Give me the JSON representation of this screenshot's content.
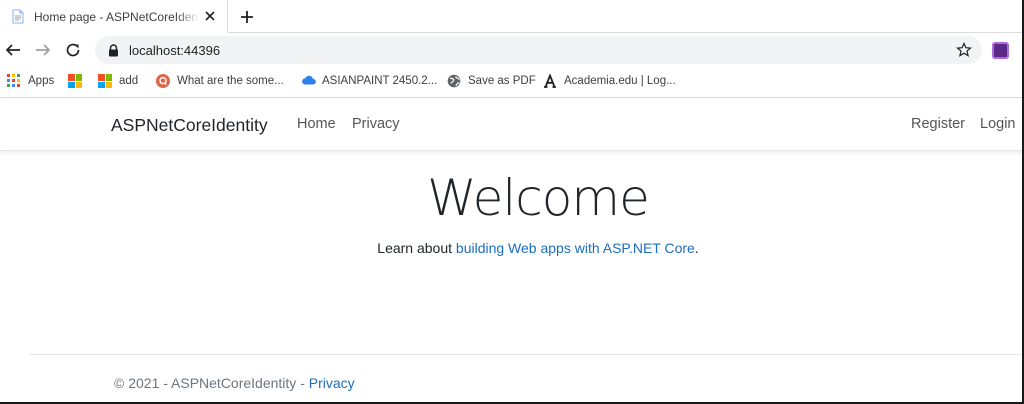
{
  "browser": {
    "tab_title": "Home page - ASPNetCoreIdentity",
    "url": "localhost:44396",
    "bookmarks": [
      {
        "label": "Apps",
        "icon": "apps-grid-icon"
      },
      {
        "label": "",
        "icon": "microsoft-logo-icon"
      },
      {
        "label": "add",
        "icon": "microsoft-logo-icon"
      },
      {
        "label": "What are the some...",
        "icon": "quora-icon"
      },
      {
        "label": "ASIANPAINT 2450.2...",
        "icon": "cloud-icon"
      },
      {
        "label": "Save as PDF",
        "icon": "globe-icon"
      },
      {
        "label": "Academia.edu | Log...",
        "icon": "academia-icon"
      }
    ]
  },
  "site": {
    "brand": "ASPNetCoreIdentity",
    "nav": {
      "home": "Home",
      "privacy": "Privacy",
      "register": "Register",
      "login": "Login"
    },
    "welcome": "Welcome",
    "learn_prefix": "Learn about ",
    "learn_link": "building Web apps with ASP.NET Core",
    "learn_suffix": ".",
    "footer_prefix": "© 2021 - ASPNetCoreIdentity - ",
    "footer_link": "Privacy"
  },
  "colors": {
    "link": "#1b6ec2",
    "text": "#212529",
    "muted": "#6c757d"
  }
}
